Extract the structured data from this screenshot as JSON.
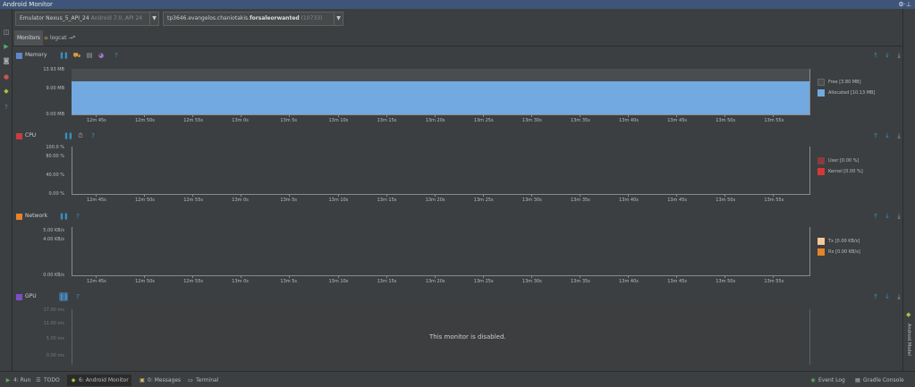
{
  "window": {
    "title": "Android Monitor"
  },
  "toolbar": {
    "device": {
      "name": "Emulator Nexus_5_API_24",
      "detail": " Android 7.0, API 24"
    },
    "process": {
      "name_prefix": "tp3646.evangelos.chaniotakis.",
      "name_bold": "forsaleorwanted",
      "pid": " (10733)"
    }
  },
  "tabs": {
    "monitors": "Monitors",
    "logcat": "logcat",
    "logcat_suffix": "→*"
  },
  "time_ticks": [
    "12m 45s",
    "12m 50s",
    "12m 55s",
    "13m 0s",
    "13m 5s",
    "13m 10s",
    "13m 15s",
    "13m 20s",
    "13m 25s",
    "13m 30s",
    "13m 35s",
    "13m 40s",
    "13m 45s",
    "13m 50s",
    "13m 55s"
  ],
  "memory": {
    "title": "Memory",
    "color": "#5e88c7",
    "yticks": [
      "13.93 MB",
      "9.00 MB",
      "0.00 MB"
    ],
    "legend": [
      {
        "label": "Free [3.80 MB]",
        "color": "#4a4d4f"
      },
      {
        "label": "Allocated [10.13 MB]",
        "color": "#72a9e0"
      }
    ]
  },
  "cpu": {
    "title": "CPU",
    "color": "#c93d3d",
    "yticks": [
      "100.0 %",
      "80.00 %",
      "40.00 %",
      "0.00 %"
    ],
    "legend": [
      {
        "label": "User [0.00 %]",
        "color": "#8b3b3e"
      },
      {
        "label": "Kernel [0.00 %]",
        "color": "#d63838"
      }
    ]
  },
  "network": {
    "title": "Network",
    "color": "#e6842b",
    "yticks": [
      "5.00 KB/s",
      "4.00 KB/s",
      "0.00 KB/s"
    ],
    "legend": [
      {
        "label": "Tx [0.00 KB/s]",
        "color": "#f4c89a"
      },
      {
        "label": "Rx [0.00 KB/s]",
        "color": "#e6842b"
      }
    ]
  },
  "gpu": {
    "title": "GPU",
    "color": "#7b4fc7",
    "yticks": [
      "17.00 ms",
      "11.00 ms",
      "5.00 ms",
      "0.00 ms"
    ],
    "disabled_msg": "This monitor is disabled."
  },
  "chart_data": [
    {
      "type": "area",
      "title": "Memory",
      "x": [
        "12m 45s",
        "12m 50s",
        "12m 55s",
        "13m 0s",
        "13m 5s",
        "13m 10s",
        "13m 15s",
        "13m 20s",
        "13m 25s",
        "13m 30s",
        "13m 35s",
        "13m 40s",
        "13m 45s",
        "13m 50s",
        "13m 55s"
      ],
      "series": [
        {
          "name": "Allocated [10.13 MB]",
          "values": [
            10.13,
            10.13,
            10.13,
            10.13,
            10.13,
            10.13,
            10.13,
            10.13,
            10.13,
            10.13,
            10.13,
            10.13,
            10.13,
            10.13,
            10.13
          ]
        },
        {
          "name": "Free [3.80 MB]",
          "values": [
            3.8,
            3.8,
            3.8,
            3.8,
            3.8,
            3.8,
            3.8,
            3.8,
            3.8,
            3.8,
            3.8,
            3.8,
            3.8,
            3.8,
            3.8
          ]
        }
      ],
      "ylim": [
        0,
        13.93
      ]
    },
    {
      "type": "area",
      "title": "CPU",
      "x": [
        "12m 45s",
        "12m 50s",
        "12m 55s",
        "13m 0s",
        "13m 5s",
        "13m 10s",
        "13m 15s",
        "13m 20s",
        "13m 25s",
        "13m 30s",
        "13m 35s",
        "13m 40s",
        "13m 45s",
        "13m 50s",
        "13m 55s"
      ],
      "series": [
        {
          "name": "User [0.00 %]",
          "values": [
            0,
            0,
            0,
            0,
            0,
            0,
            0,
            0,
            0,
            0,
            0,
            0,
            0,
            0,
            0
          ]
        },
        {
          "name": "Kernel [0.00 %]",
          "values": [
            0,
            0,
            0,
            0,
            0,
            0,
            0,
            0,
            0,
            0,
            0,
            0,
            0,
            0,
            0
          ]
        }
      ],
      "ylim": [
        0,
        100
      ]
    },
    {
      "type": "area",
      "title": "Network",
      "x": [
        "12m 45s",
        "12m 50s",
        "12m 55s",
        "13m 0s",
        "13m 5s",
        "13m 10s",
        "13m 15s",
        "13m 20s",
        "13m 25s",
        "13m 30s",
        "13m 35s",
        "13m 40s",
        "13m 45s",
        "13m 50s",
        "13m 55s"
      ],
      "series": [
        {
          "name": "Tx [0.00 KB/s]",
          "values": [
            0,
            0,
            0,
            0,
            0,
            0,
            0,
            0,
            0,
            0,
            0,
            0,
            0,
            0,
            0
          ]
        },
        {
          "name": "Rx [0.00 KB/s]",
          "values": [
            0,
            0,
            0,
            0,
            0,
            0,
            0,
            0,
            0,
            0,
            0,
            0,
            0,
            0,
            0
          ]
        }
      ],
      "ylim": [
        0,
        5
      ]
    }
  ],
  "statusbar": {
    "run": "4: Run",
    "todo": "TODO",
    "android_monitor": "6: Android Monitor",
    "messages": "0: Messages",
    "terminal": "Terminal",
    "event_log": "Event Log",
    "gradle_console": "Gradle Console"
  },
  "right_strip": {
    "label": "Android Model"
  }
}
